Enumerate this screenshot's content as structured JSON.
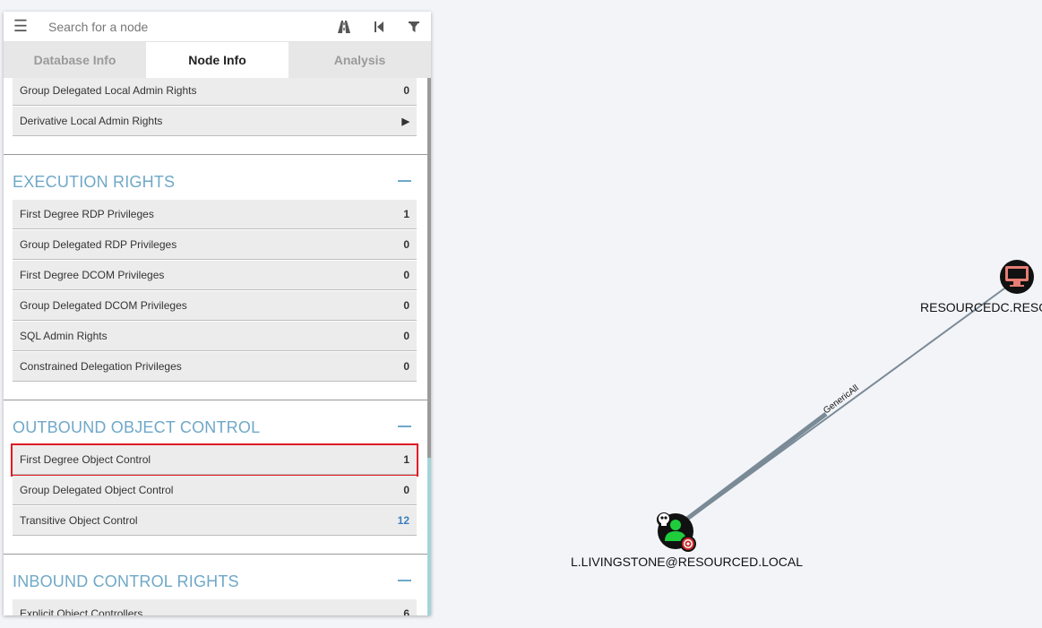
{
  "search": {
    "placeholder": "Search for a node",
    "menu_icon": "hamburger-icon",
    "pathfinding_icon": "road-icon",
    "back_icon": "step-backward-icon",
    "filter_icon": "filter-icon"
  },
  "tabs": [
    {
      "label": "Database Info",
      "active": false
    },
    {
      "label": "Node Info",
      "active": true
    },
    {
      "label": "Analysis",
      "active": false
    }
  ],
  "local_admin": {
    "rows": [
      {
        "label": "Group Delegated Local Admin Rights",
        "value": "0"
      },
      {
        "label": "Derivative Local Admin Rights",
        "value": "▶"
      }
    ]
  },
  "execution_rights": {
    "title": "EXECUTION RIGHTS",
    "rows": [
      {
        "label": "First Degree RDP Privileges",
        "value": "1"
      },
      {
        "label": "Group Delegated RDP Privileges",
        "value": "0"
      },
      {
        "label": "First Degree DCOM Privileges",
        "value": "0"
      },
      {
        "label": "Group Delegated DCOM Privileges",
        "value": "0"
      },
      {
        "label": "SQL Admin Rights",
        "value": "0"
      },
      {
        "label": "Constrained Delegation Privileges",
        "value": "0"
      }
    ]
  },
  "outbound_control": {
    "title": "OUTBOUND OBJECT CONTROL",
    "rows": [
      {
        "label": "First Degree Object Control",
        "value": "1"
      },
      {
        "label": "Group Delegated Object Control",
        "value": "0"
      },
      {
        "label": "Transitive Object Control",
        "value": "12"
      }
    ]
  },
  "inbound_control": {
    "title": "INBOUND CONTROL RIGHTS",
    "rows": [
      {
        "label": "Explicit Object Controllers",
        "value": "6"
      }
    ]
  },
  "graph": {
    "nodes": [
      {
        "label": "L.LIVINGSTONE@RESOURCED.LOCAL",
        "type": "user",
        "owned": true,
        "high_value": true
      },
      {
        "label": "RESOURCEDC.RESOU",
        "type": "computer"
      }
    ],
    "edge_label": "GenericAll",
    "colors": {
      "user_node": "#1fcc3c",
      "computer_node": "#e77d74",
      "edge": "#7a8a96",
      "section_title": "#6fa8c8",
      "highlight": "#e01b24"
    }
  }
}
